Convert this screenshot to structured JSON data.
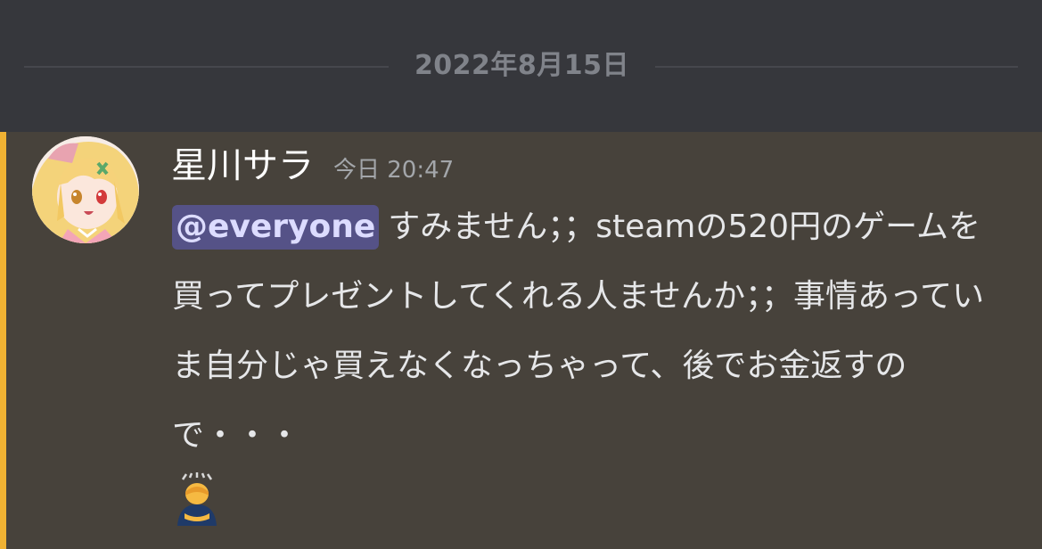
{
  "date_divider": {
    "label": "2022年8月15日"
  },
  "message": {
    "author": "星川サラ",
    "timestamp": "今日 20:47",
    "mention": "@everyone",
    "text": "すみません；；steamの520円のゲームを買ってプレゼントしてくれる人ませんか；；事情あっていま自分じゃ買えなくなっちゃって、後でお金返すので・・・",
    "emoji": "bowing-person-emoji",
    "highlight_color": "#f0b233",
    "mention_color": "#555287"
  },
  "icons": {
    "avatar": "anime-girl-avatar"
  }
}
